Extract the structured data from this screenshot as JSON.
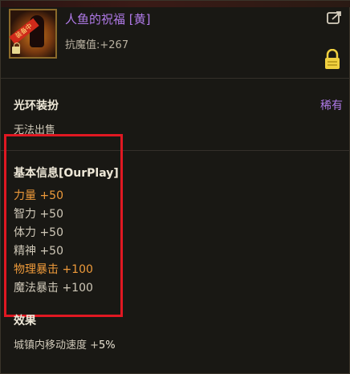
{
  "item": {
    "name": "人鱼的祝福 [黄]",
    "anti_magic": "抗魔值:+267",
    "icon_badge": "装备中"
  },
  "avatar_section": {
    "title": "光环装扮",
    "rarity": "稀有",
    "trade_status": "无法出售"
  },
  "basic_info": {
    "title": "基本信息[OurPlay]",
    "stats": [
      {
        "label": "力量 +50",
        "color": "#ee9a3a"
      },
      {
        "label": "智力 +50",
        "color": "#cfc8b8"
      },
      {
        "label": "体力 +50",
        "color": "#cfc8b8"
      },
      {
        "label": "精神 +50",
        "color": "#cfc8b8"
      },
      {
        "label": "物理暴击 +100",
        "color": "#ee9a3a"
      },
      {
        "label": "魔法暴击 +100",
        "color": "#cfc8b8"
      }
    ]
  },
  "effects": {
    "title": "效果",
    "move_speed_label": "城镇内移动速度 +",
    "move_speed_value": "5%"
  },
  "colors": {
    "rarity_purple": "#b07ae8",
    "stat_orange": "#ee9a3a",
    "highlight_red": "#e01822"
  },
  "icons": {
    "share": "share-icon",
    "lock": "lock-icon"
  }
}
